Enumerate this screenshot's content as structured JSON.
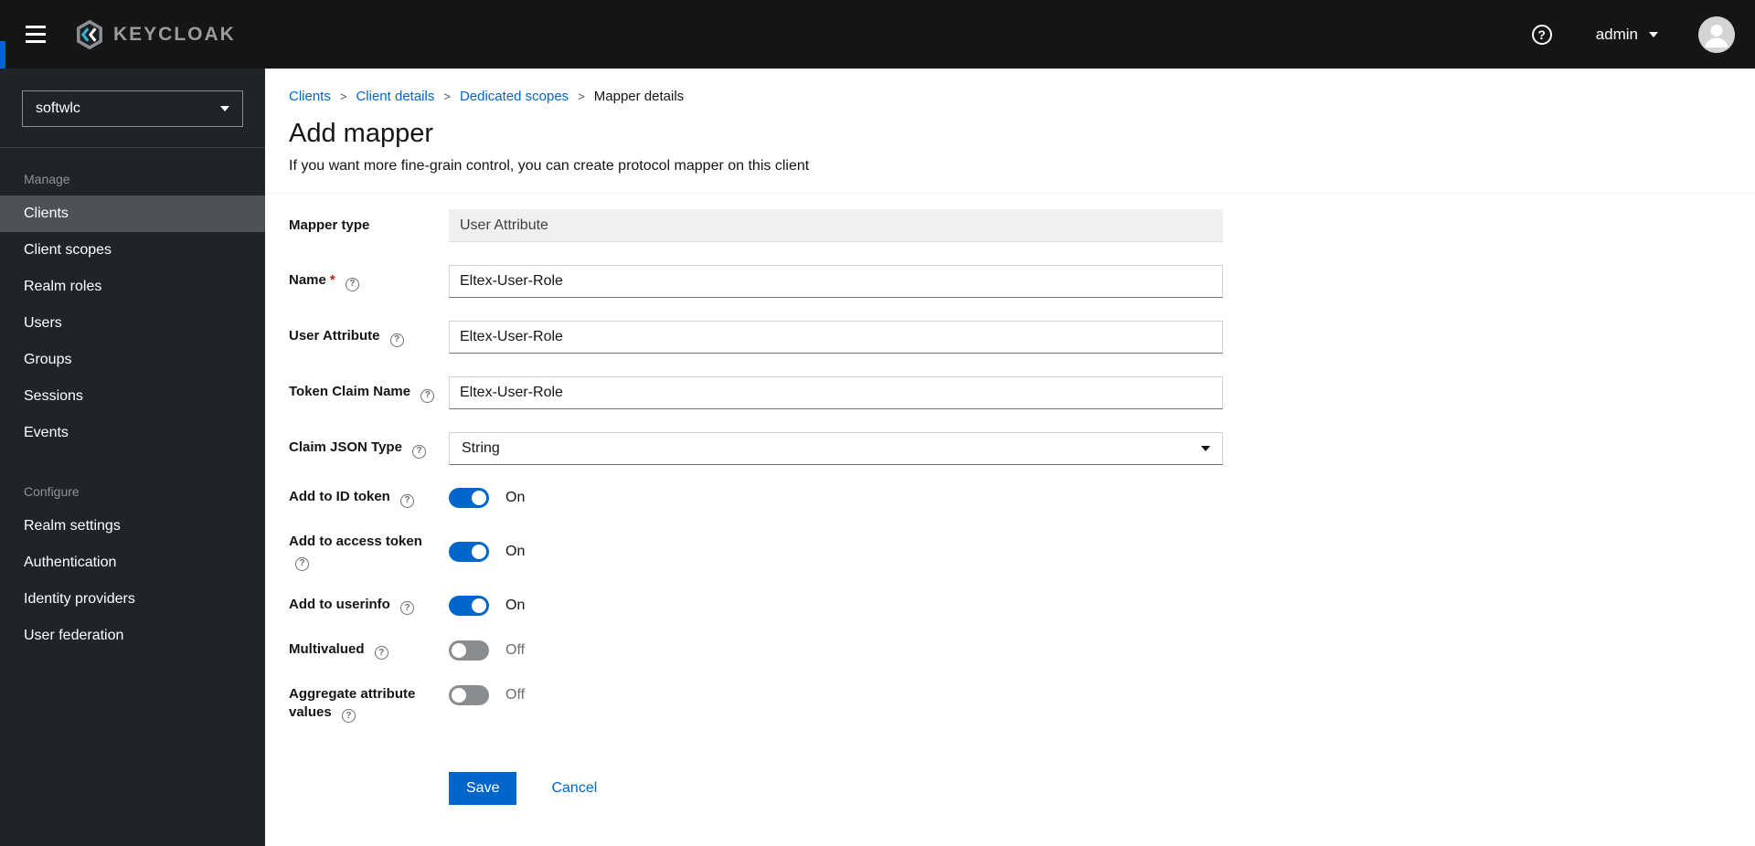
{
  "theme": {
    "accent_blue": "#0066cc",
    "header_bg": "#151515",
    "sidebar_bg": "#212427",
    "sidebar_active_bg": "#4f5255",
    "toggle_on": "#0066cc",
    "toggle_off": "#8a8d90",
    "link_blue": "#0066cc",
    "danger_red": "#c9190b"
  },
  "icons": {
    "help_glyph": "?",
    "menu": "hamburger-icon",
    "header_help": "question-circle-icon",
    "caret": "chevron-down-icon",
    "avatar": "user-avatar-icon",
    "logo": "keycloak-logo-icon"
  },
  "header": {
    "brand_text": "KEYCLOAK",
    "username": "admin"
  },
  "sidebar": {
    "realm_selector_value": "softwlc",
    "sections": [
      {
        "title": "Manage",
        "items": [
          {
            "label": "Clients",
            "active": true
          },
          {
            "label": "Client scopes",
            "active": false
          },
          {
            "label": "Realm roles",
            "active": false
          },
          {
            "label": "Users",
            "active": false
          },
          {
            "label": "Groups",
            "active": false
          },
          {
            "label": "Sessions",
            "active": false
          },
          {
            "label": "Events",
            "active": false
          }
        ]
      },
      {
        "title": "Configure",
        "items": [
          {
            "label": "Realm settings",
            "active": false
          },
          {
            "label": "Authentication",
            "active": false
          },
          {
            "label": "Identity providers",
            "active": false
          },
          {
            "label": "User federation",
            "active": false
          }
        ]
      }
    ]
  },
  "breadcrumb": {
    "separator": ">",
    "items": [
      {
        "label": "Clients",
        "link": true
      },
      {
        "label": "Client details",
        "link": true
      },
      {
        "label": "Dedicated scopes",
        "link": true
      },
      {
        "label": "Mapper details",
        "link": false
      }
    ]
  },
  "page": {
    "title": "Add mapper",
    "subtitle": "If you want more fine-grain control, you can create protocol mapper on this client"
  },
  "form": {
    "required_marker": "*",
    "help_glyph": "?",
    "fields": {
      "mapper_type": {
        "label": "Mapper type",
        "value": "User Attribute",
        "readonly": true
      },
      "name": {
        "label": "Name",
        "value": "Eltex-User-Role",
        "required": true
      },
      "user_attribute": {
        "label": "User Attribute",
        "value": "Eltex-User-Role"
      },
      "token_claim_name": {
        "label": "Token Claim Name",
        "value": "Eltex-User-Role"
      },
      "claim_json_type": {
        "label": "Claim JSON Type",
        "value": "String"
      },
      "add_to_id_token": {
        "label": "Add to ID token",
        "state": "On"
      },
      "add_to_access_token": {
        "label": "Add to access token",
        "state": "On"
      },
      "add_to_userinfo": {
        "label": "Add to userinfo",
        "state": "On"
      },
      "multivalued": {
        "label": "Multivalued",
        "state": "Off"
      },
      "aggregate_attribute_values": {
        "label": "Aggregate attribute values",
        "state": "Off"
      }
    },
    "actions": {
      "save_label": "Save",
      "cancel_label": "Cancel"
    }
  }
}
